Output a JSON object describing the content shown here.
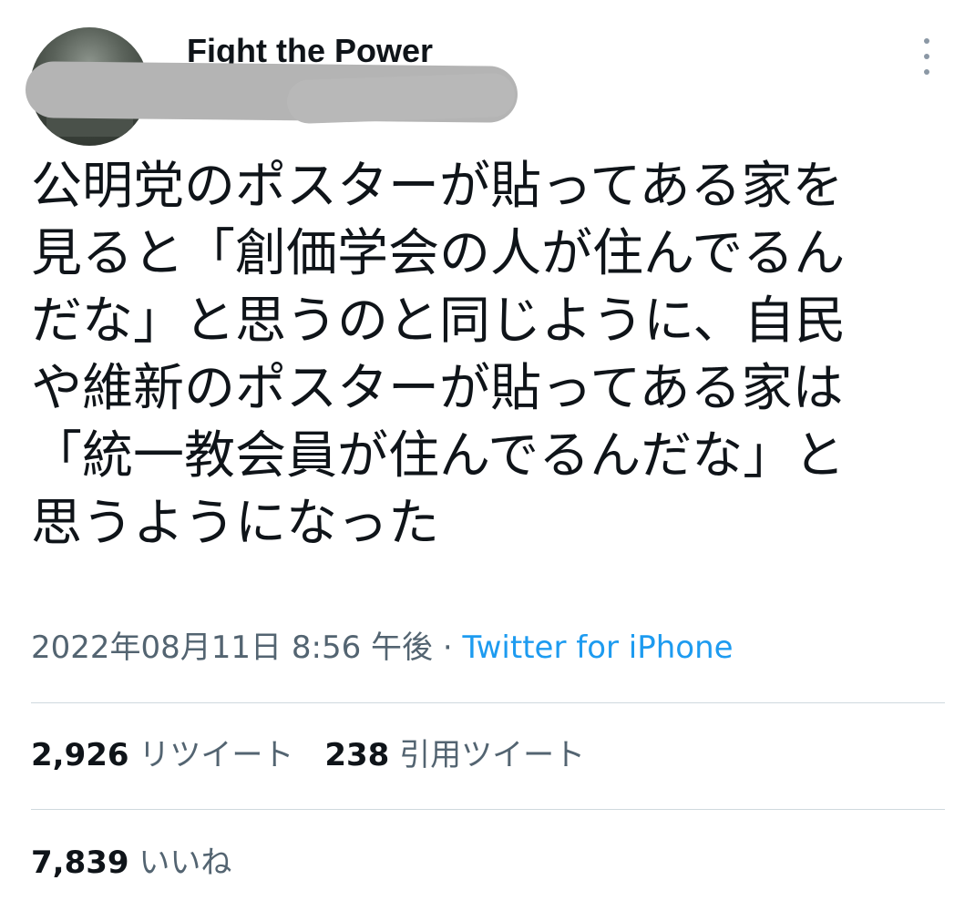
{
  "author": {
    "display_name": "Fight the Power",
    "handle": "@"
  },
  "tweet": {
    "text_lines": [
      "公明党のポスターが貼ってある家を",
      "見ると「創価学会の人が住んでるん",
      "だな」と思うのと同じように、自民",
      "や維新のポスターが貼ってある家は",
      "「統一教会員が住んでるんだな」と",
      "思うようになった"
    ],
    "timestamp": "2022年08月11日 8:56 午後",
    "separator": " · ",
    "source": "Twitter for iPhone"
  },
  "stats": {
    "retweets": {
      "count": "2,926",
      "label": "リツイート"
    },
    "quotes": {
      "count": "238",
      "label": "引用ツイート"
    },
    "likes": {
      "count": "7,839",
      "label": "いいね"
    }
  },
  "icons": {
    "more": "more-vertical-icon",
    "avatar": "avatar"
  },
  "colors": {
    "text": "#0f1419",
    "secondary": "#536471",
    "link": "#1d9bf0",
    "divider": "#cfd9de",
    "redaction": "#b4b4b4"
  }
}
